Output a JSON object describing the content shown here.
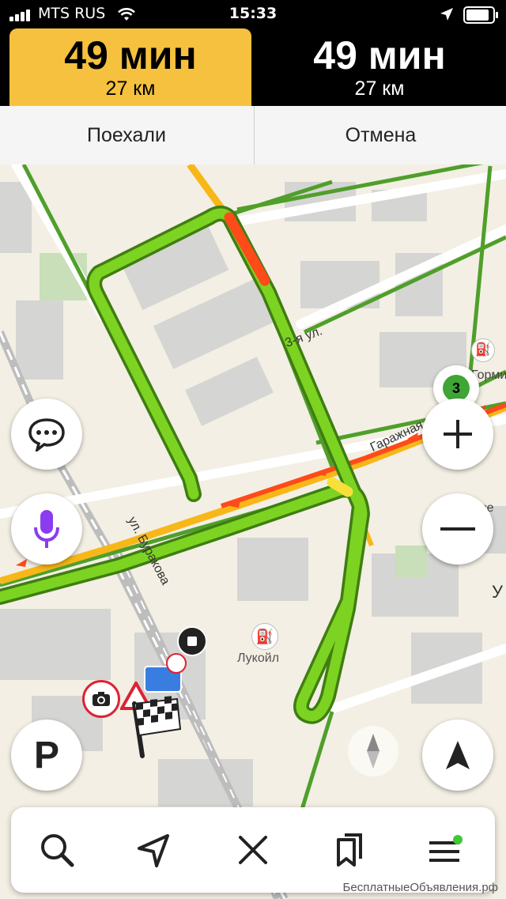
{
  "status_bar": {
    "carrier": "MTS RUS",
    "time": "15:33",
    "battery_percent": 90
  },
  "routes": [
    {
      "duration": "49 мин",
      "distance": "27 км",
      "selected": true
    },
    {
      "duration": "49 мин",
      "distance": "27 км",
      "selected": false
    }
  ],
  "actions": {
    "go_label": "Поехали",
    "cancel_label": "Отмена"
  },
  "map": {
    "street_labels": {
      "burakova": "ул. Буракова",
      "garazhnaya": "Гаражная ул.",
      "third": "3-я ул.",
      "shosse": "Шоссе Э",
      "top_right": "Гормине",
      "lukoil": "Лукойл",
      "right_edge": "У"
    },
    "traffic_level": "3",
    "colors": {
      "route": "#7dd321",
      "route_outline": "#3f7d12",
      "jam": "#ff4a1a",
      "slow": "#f7b718",
      "accent": "#f5c13e"
    }
  },
  "controls": {
    "messages": "chat-icon",
    "voice": "microphone-icon",
    "zoom_in": "plus-icon",
    "zoom_out": "minus-icon",
    "parking_label": "P",
    "compass": "compass-icon",
    "locate": "navigation-arrow-icon"
  },
  "bottom_nav": [
    "search-icon",
    "navigation-icon",
    "close-icon",
    "bookmarks-icon",
    "menu-icon"
  ],
  "watermark": "БесплатныеОбъявления.рф"
}
